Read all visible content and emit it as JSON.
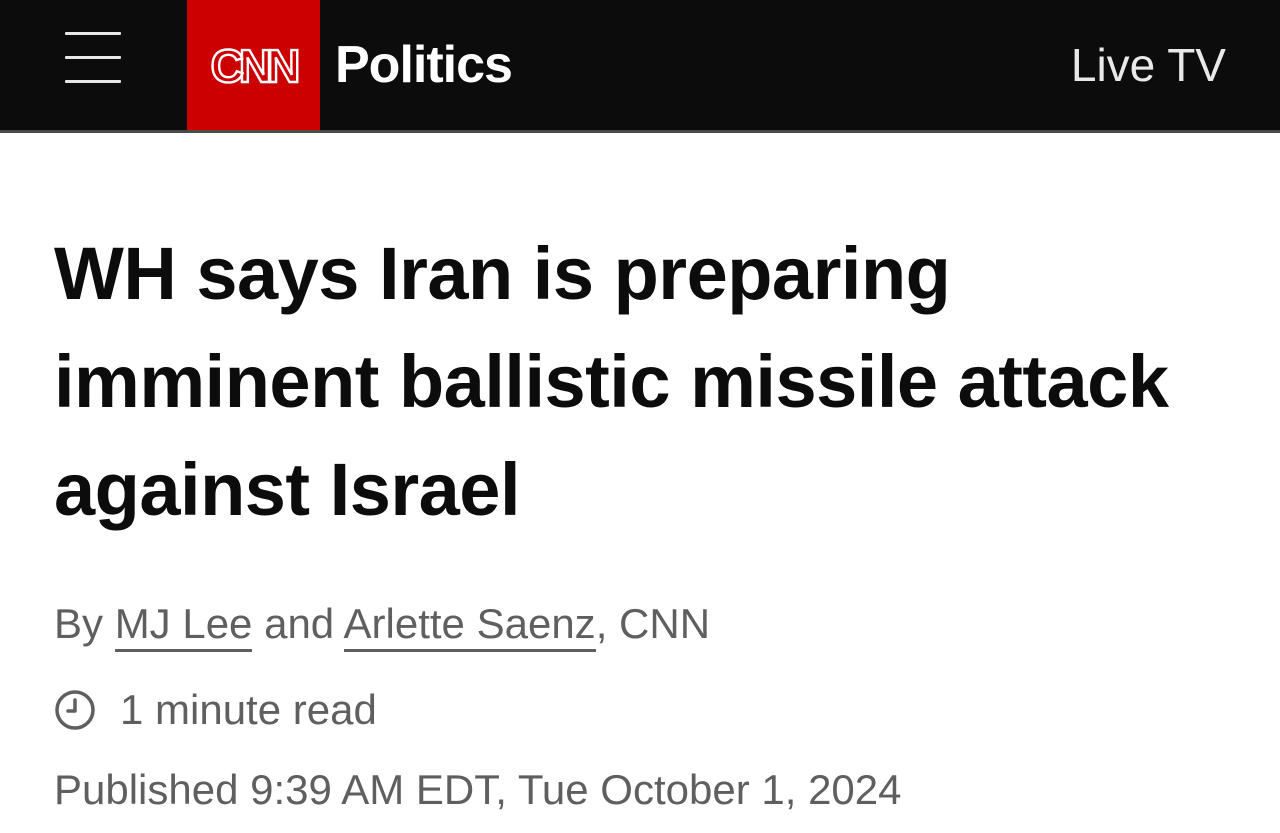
{
  "header": {
    "logo": "CNN",
    "section_title": "Politics",
    "live_tv_label": "Live TV",
    "menu_icon": "hamburger-menu-icon"
  },
  "article": {
    "headline": "WH says Iran is preparing imminent ballistic missile attack against Israel",
    "byline": {
      "prefix": "By",
      "author_1": "MJ Lee",
      "conjunction": "and",
      "author_2": "Arlette Saenz",
      "suffix": ", CNN"
    },
    "read_time": {
      "icon": "clock-icon",
      "text": "1 minute read"
    },
    "published": "Published 9:39 AM EDT, Tue October 1, 2024"
  },
  "colors": {
    "header_bg": "#0c0c0c",
    "brand_red": "#cc0000",
    "headline_text": "#0c0c0c",
    "meta_text": "#5f5f5f"
  }
}
